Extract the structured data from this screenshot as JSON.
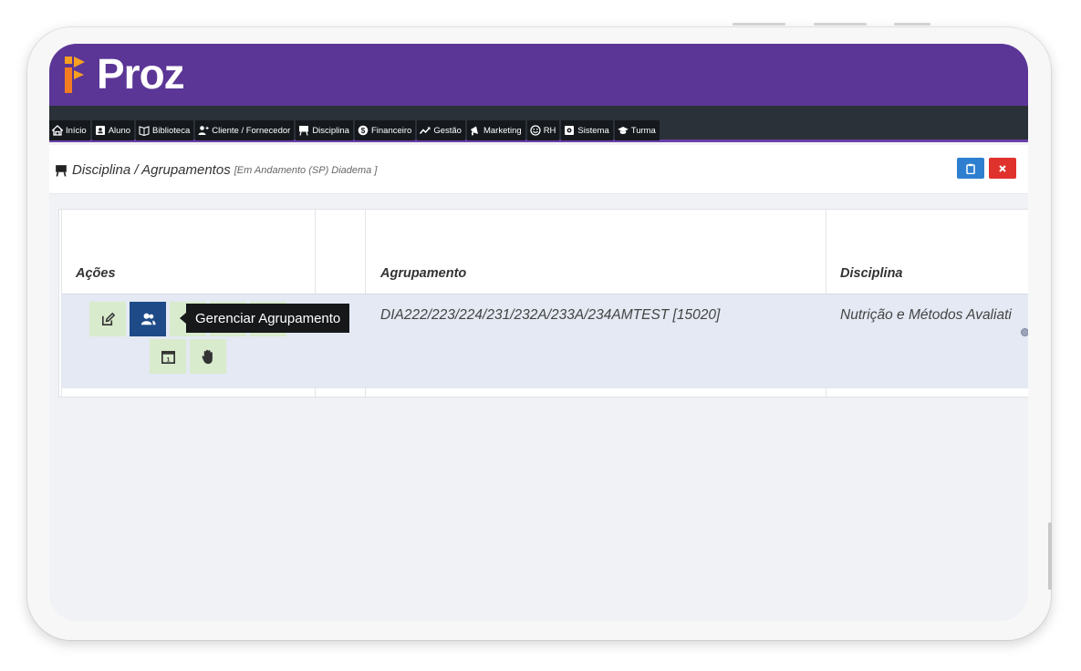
{
  "app": {
    "logo_text": "Proz"
  },
  "nav": {
    "items": [
      {
        "label": "Início",
        "icon": "home-icon"
      },
      {
        "label": "Aluno",
        "icon": "id-card-icon"
      },
      {
        "label": "Biblioteca",
        "icon": "book-icon"
      },
      {
        "label": "Cliente / Fornecedor",
        "icon": "user-plus-icon"
      },
      {
        "label": "Disciplina",
        "icon": "easel-icon"
      },
      {
        "label": "Financeiro",
        "icon": "money-icon"
      },
      {
        "label": "Gestão",
        "icon": "trend-icon"
      },
      {
        "label": "Marketing",
        "icon": "megaphone-icon"
      },
      {
        "label": "RH",
        "icon": "smile-icon"
      },
      {
        "label": "Sistema",
        "icon": "cog-icon"
      },
      {
        "label": "Turma",
        "icon": "graduation-cap-icon"
      }
    ]
  },
  "page": {
    "title": "Disciplina / Agrupamentos",
    "subtitle": "[Em Andamento (SP) Diadema ]",
    "title_icon": "easel-icon",
    "header_buttons": [
      {
        "icon": "clipboard-icon",
        "color": "#2f7fd0"
      },
      {
        "label": "×",
        "icon": "close-icon",
        "color": "#e0322d"
      }
    ]
  },
  "table": {
    "columns": [
      "Ações",
      "Agrupamento",
      "Disciplina"
    ],
    "rows": [
      {
        "agrupamento": "DIA222/223/224/231/232A/233A/234AMTEST [15020]",
        "disciplina": "Nutrição e Métodos Avaliati"
      }
    ],
    "actions": [
      {
        "icon": "edit-icon",
        "active": false
      },
      {
        "icon": "users-icon",
        "active": true
      },
      {
        "icon": "calendar-icon",
        "active": false
      },
      {
        "icon": "hand-icon",
        "active": false
      }
    ],
    "tooltip": "Gerenciar Agrupamento"
  },
  "colors": {
    "brand": "#5b3696",
    "navbar": "#2b3138",
    "action_bg": "#d9ebcd",
    "action_active": "#1e4b88"
  }
}
